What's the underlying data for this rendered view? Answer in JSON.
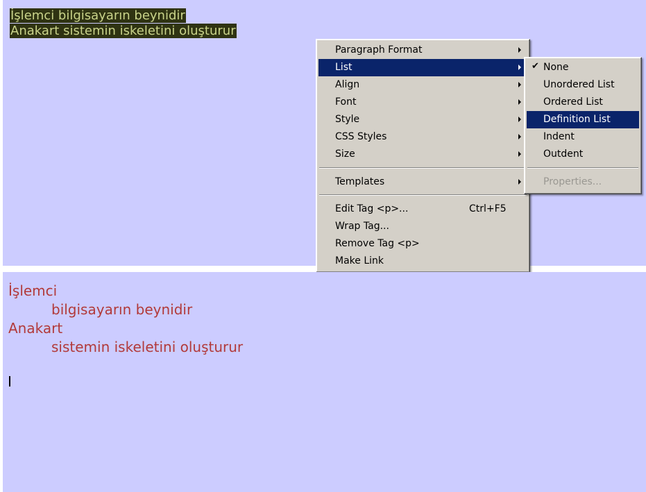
{
  "editor_top": {
    "selected_lines": [
      "İşlemci bilgisayarın beynidir",
      "Anakart sistemin iskeletini oluşturur"
    ]
  },
  "context_menu": {
    "items": [
      {
        "label": "Paragraph Format",
        "has_submenu": true
      },
      {
        "label": "List",
        "has_submenu": true,
        "active": true
      },
      {
        "label": "Align",
        "has_submenu": true
      },
      {
        "label": "Font",
        "has_submenu": true
      },
      {
        "label": "Style",
        "has_submenu": true
      },
      {
        "label": "CSS Styles",
        "has_submenu": true
      },
      {
        "label": "Size",
        "has_submenu": true
      },
      {
        "label": "Templates",
        "has_submenu": true
      },
      {
        "label": "Edit Tag <p>...",
        "shortcut": "Ctrl+F5"
      },
      {
        "label": "Wrap Tag..."
      },
      {
        "label": "Remove Tag <p>"
      },
      {
        "label": "Make Link"
      }
    ]
  },
  "list_submenu": {
    "items": [
      {
        "label": "None",
        "checked": true
      },
      {
        "label": "Unordered List"
      },
      {
        "label": "Ordered List"
      },
      {
        "label": "Definition List",
        "active": true
      },
      {
        "label": "Indent"
      },
      {
        "label": "Outdent"
      },
      {
        "label": "Properties...",
        "disabled": true
      }
    ]
  },
  "editor_bottom": {
    "definition_list": [
      {
        "term": "İşlemci",
        "definition": "bilgisayarın beynidir"
      },
      {
        "term": "Anakart",
        "definition": "sistemin iskeletini oluşturur"
      }
    ]
  },
  "colors": {
    "editor_background": "#ccccff",
    "selection_background": "#2f3312",
    "selection_text": "#c9d38a",
    "menu_background": "#d4d0c8",
    "menu_highlight": "#0a246a",
    "list_text": "#b23a3a"
  }
}
